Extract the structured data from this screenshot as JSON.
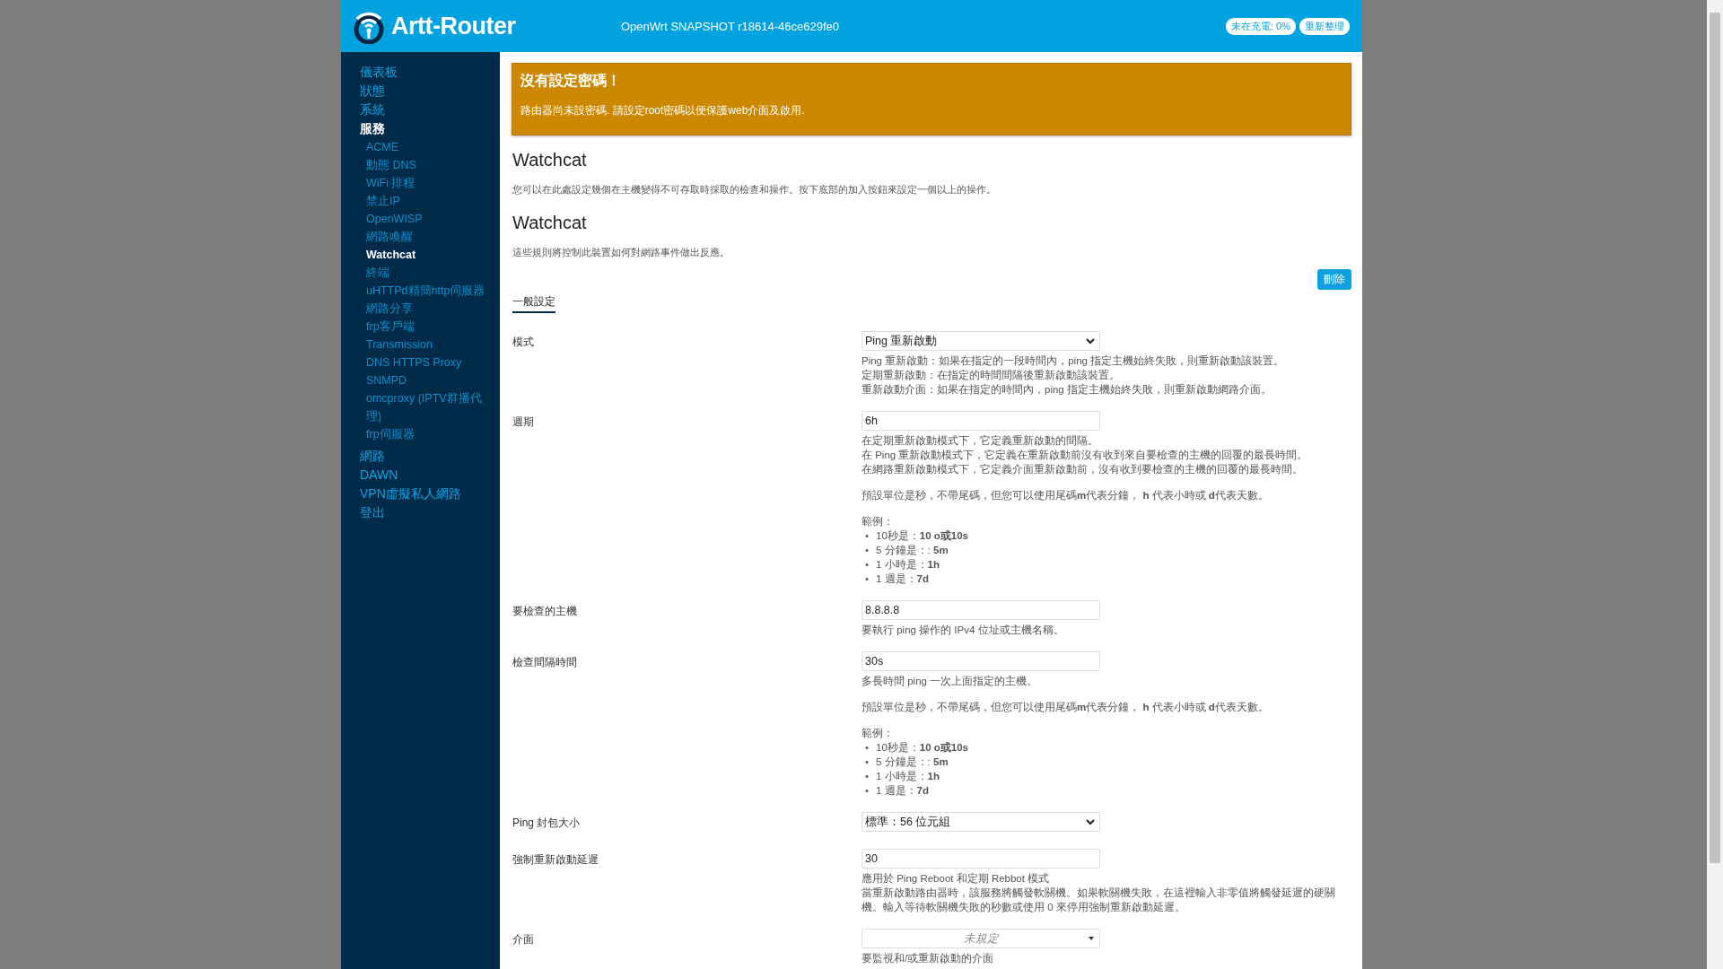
{
  "header": {
    "brand": "Artt-Router",
    "version": "OpenWrt SNAPSHOT r18614-46ce629fe0",
    "badges": [
      "未在充電: 0%",
      "重新整理"
    ]
  },
  "sidebar": {
    "items": [
      {
        "label": "儀表板",
        "selected": false
      },
      {
        "label": "狀態",
        "selected": false
      },
      {
        "label": "系統",
        "selected": false
      },
      {
        "label": "服務",
        "selected": true,
        "children": [
          {
            "label": "ACME",
            "selected": false
          },
          {
            "label": "動態 DNS",
            "selected": false
          },
          {
            "label": "WiFi 排程",
            "selected": false
          },
          {
            "label": "禁止IP",
            "selected": false
          },
          {
            "label": "OpenWISP",
            "selected": false
          },
          {
            "label": "網路喚醒",
            "selected": false
          },
          {
            "label": "Watchcat",
            "selected": true
          },
          {
            "label": "終端",
            "selected": false
          },
          {
            "label": "uHTTPd精簡http伺服器",
            "selected": false
          },
          {
            "label": "網路分享",
            "selected": false
          },
          {
            "label": "frp客戶端",
            "selected": false
          },
          {
            "label": "Transmission",
            "selected": false
          },
          {
            "label": "DNS HTTPS Proxy",
            "selected": false
          },
          {
            "label": "SNMPD",
            "selected": false
          },
          {
            "label": "omcproxy (IPTV群播代理)",
            "selected": false
          },
          {
            "label": "frp伺服器",
            "selected": false
          }
        ]
      },
      {
        "label": "網路",
        "selected": false
      },
      {
        "label": "DAWN",
        "selected": false
      },
      {
        "label": "VPN虛擬私人網路",
        "selected": false
      },
      {
        "label": "登出",
        "selected": false
      }
    ]
  },
  "alert": {
    "title": "沒有設定密碼！",
    "message": "路由器尚未設密碼. 請設定root密碼以便保護web介面及啟用."
  },
  "page": {
    "title": "Watchcat",
    "description": "您可以在此處設定幾個在主機變得不可存取時採取的檢查和操作。按下底部的加入按鈕來設定一個以上的操作。"
  },
  "section": {
    "title": "Watchcat",
    "description": "這些規則將控制此裝置如何對網路事件做出反應。",
    "delete_button": "刪除",
    "tabs": [
      {
        "label": "一般設定",
        "selected": true
      }
    ]
  },
  "fields": [
    {
      "label": "模式",
      "kind": "select",
      "value": "Ping 重新啟動",
      "help": [
        {
          "kind": "lines",
          "lines": [
            "Ping 重新啟動：如果在指定的一段時間內，ping 指定主機始終失敗，則重新啟動該裝置。",
            "定期重新啟動：在指定的時間間隔後重新啟動該裝置。",
            "重新啟動介面：如果在指定的時間內，ping 指定主機始終失敗，則重新啟動網路介面。"
          ]
        }
      ]
    },
    {
      "label": "週期",
      "kind": "text",
      "value": "6h",
      "help": [
        {
          "kind": "lines",
          "lines": [
            "在定期重新啟動模式下，它定義重新啟動的間隔。",
            "在 Ping 重新啟動模式下，它定義在重新啟動前沒有收到來自要檢查的主機的回覆的最長時間。",
            "在網路重新啟動模式下，它定義介面重新啟動前，沒有收到要檢查的主機的回覆的最長時間。"
          ]
        },
        {
          "kind": "para",
          "text": "預設單位是秒，不帶尾碼，但您可以使用尾碼**m**代表分鐘， **h** 代表小時或 **d**代表天數。"
        },
        {
          "kind": "list",
          "title": "範例：",
          "marker": "•",
          "items": [
            "10秒是：**10 o或10s**",
            "5 分鐘是：: **5m**",
            "1 小時是：**1h**",
            "1 週是：**7d**"
          ]
        }
      ]
    },
    {
      "label": "要檢查的主機",
      "kind": "text",
      "value": "8.8.8.8",
      "help": [
        {
          "kind": "lines",
          "lines": [
            "要執行 ping 操作的 IPv4 位址或主機名稱。"
          ]
        }
      ]
    },
    {
      "label": "檢查間隔時間",
      "kind": "text",
      "value": "30s",
      "help": [
        {
          "kind": "lines",
          "lines": [
            "多長時間 ping 一次上面指定的主機。"
          ]
        },
        {
          "kind": "para",
          "text": "預設單位是秒，不帶尾碼，但您可以使用尾碼**m**代表分鐘， **h** 代表小時或 **d**代表天數。"
        },
        {
          "kind": "list",
          "title": "範例：",
          "marker": "•",
          "items": [
            "10秒是：**10 o或10s**",
            "5 分鐘是：: **5m**",
            "1 小時是：**1h**",
            "1 週是：**7d**"
          ]
        }
      ]
    },
    {
      "label": "Ping 封包大小",
      "kind": "select",
      "value": "標準：56 位元組"
    },
    {
      "label": "強制重新啟動延遲",
      "kind": "text",
      "value": "30",
      "help": [
        {
          "kind": "lines",
          "lines": [
            "應用於 Ping Reboot 和定期 Rebbot 模式",
            "當重新啟動路由器時，該服務將觸發軟關機。如果軟關機失敗，在這裡輸入非零值將觸發延遲的硬關機。輸入等待軟關機失敗的秒數或使用 0 來停用強制重新啟動延遲。"
          ]
        }
      ]
    },
    {
      "label": "介面",
      "kind": "dropdown",
      "placeholder": "未規定",
      "help": [
        {
          "kind": "lines",
          "lines": [
            "要監視和/或重新啟動的介面"
          ]
        }
      ]
    }
  ]
}
